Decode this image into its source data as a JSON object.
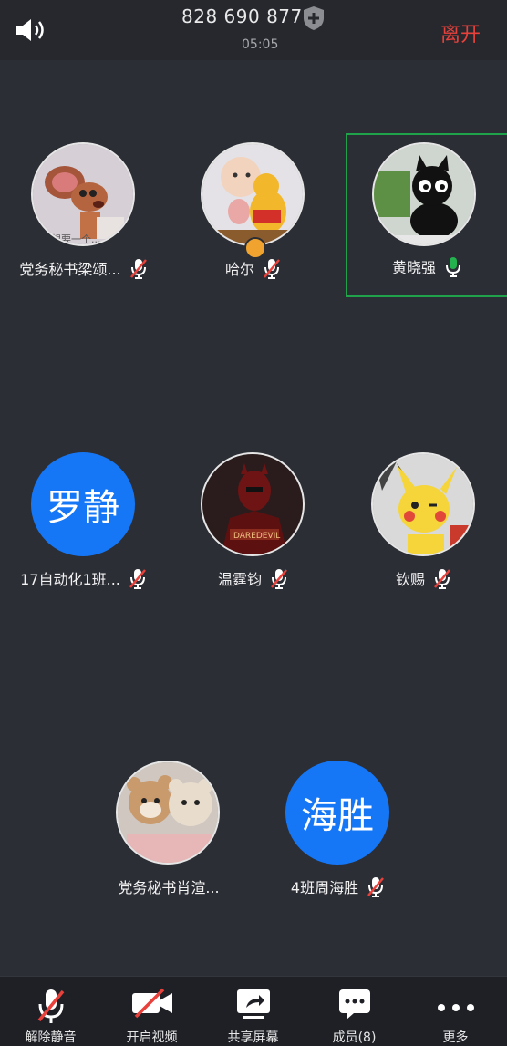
{
  "header": {
    "meeting_id": "828 690 877",
    "timer": "05:05",
    "leave_label": "离开"
  },
  "participants": [
    {
      "name": "党务秘书梁颂...",
      "avatar": "jerry-mouse-photo",
      "mic": "muted",
      "active": false
    },
    {
      "name": "哈尔",
      "avatar": "baby-pooh-photo",
      "mic": "muted",
      "host": true,
      "active": false
    },
    {
      "name": "黄晓强",
      "avatar": "black-cat-photo",
      "mic": "speaking",
      "active": true
    },
    {
      "name": "17自动化1班...",
      "avatar_text": "罗静",
      "mic": "muted",
      "active": false
    },
    {
      "name": "温霆钧",
      "avatar": "daredevil-photo",
      "mic": "muted",
      "active": false
    },
    {
      "name": "钦赐",
      "avatar": "pikachu-photo",
      "mic": "muted",
      "active": false
    },
    {
      "name": "党务秘书肖渲...",
      "avatar": "bears-photo",
      "mic": "muted",
      "active": false
    },
    {
      "name": "4班周海胜",
      "avatar_text": "海胜",
      "mic": "muted",
      "active": false
    }
  ],
  "toolbar": {
    "unmute": "解除静音",
    "video": "开启视频",
    "share": "共享屏幕",
    "members": "成员(8)",
    "more": "更多"
  },
  "colors": {
    "background": "#2c2e35",
    "leave": "#e8413b",
    "text_avatar": "#1677f6",
    "active_border": "#1fa24a",
    "mute_slash": "#e8413b"
  }
}
